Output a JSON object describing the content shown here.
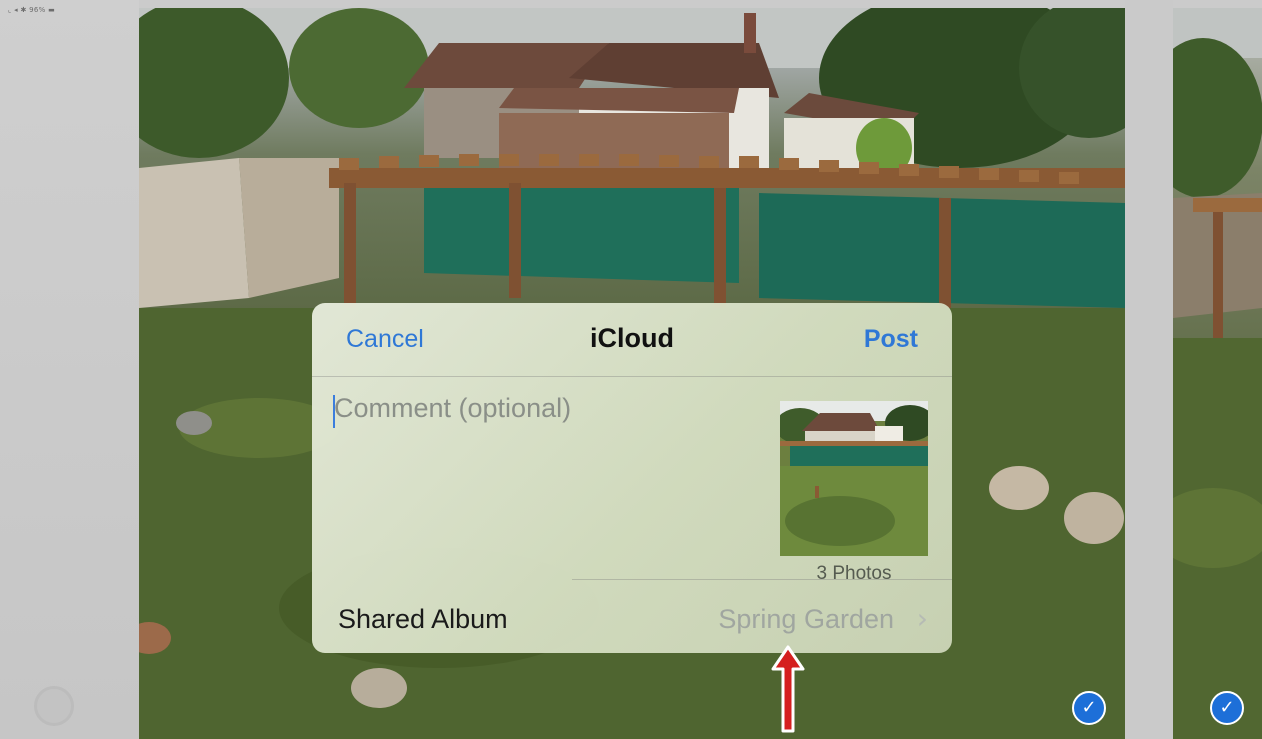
{
  "status_bar": {
    "text": "⌞ ◂ ✱ 96% ▬"
  },
  "sheet": {
    "cancel_label": "Cancel",
    "title": "iCloud",
    "post_label": "Post",
    "comment_placeholder": "Comment (optional)",
    "photos_count": "3 Photos",
    "album_label": "Shared Album",
    "album_value": "Spring Garden"
  },
  "icons": {
    "check": "✓",
    "chevron": "›"
  },
  "colors": {
    "accent_blue": "#2f78d6",
    "check_blue": "#1d6fd8",
    "arrow_red": "#d51f1f"
  }
}
